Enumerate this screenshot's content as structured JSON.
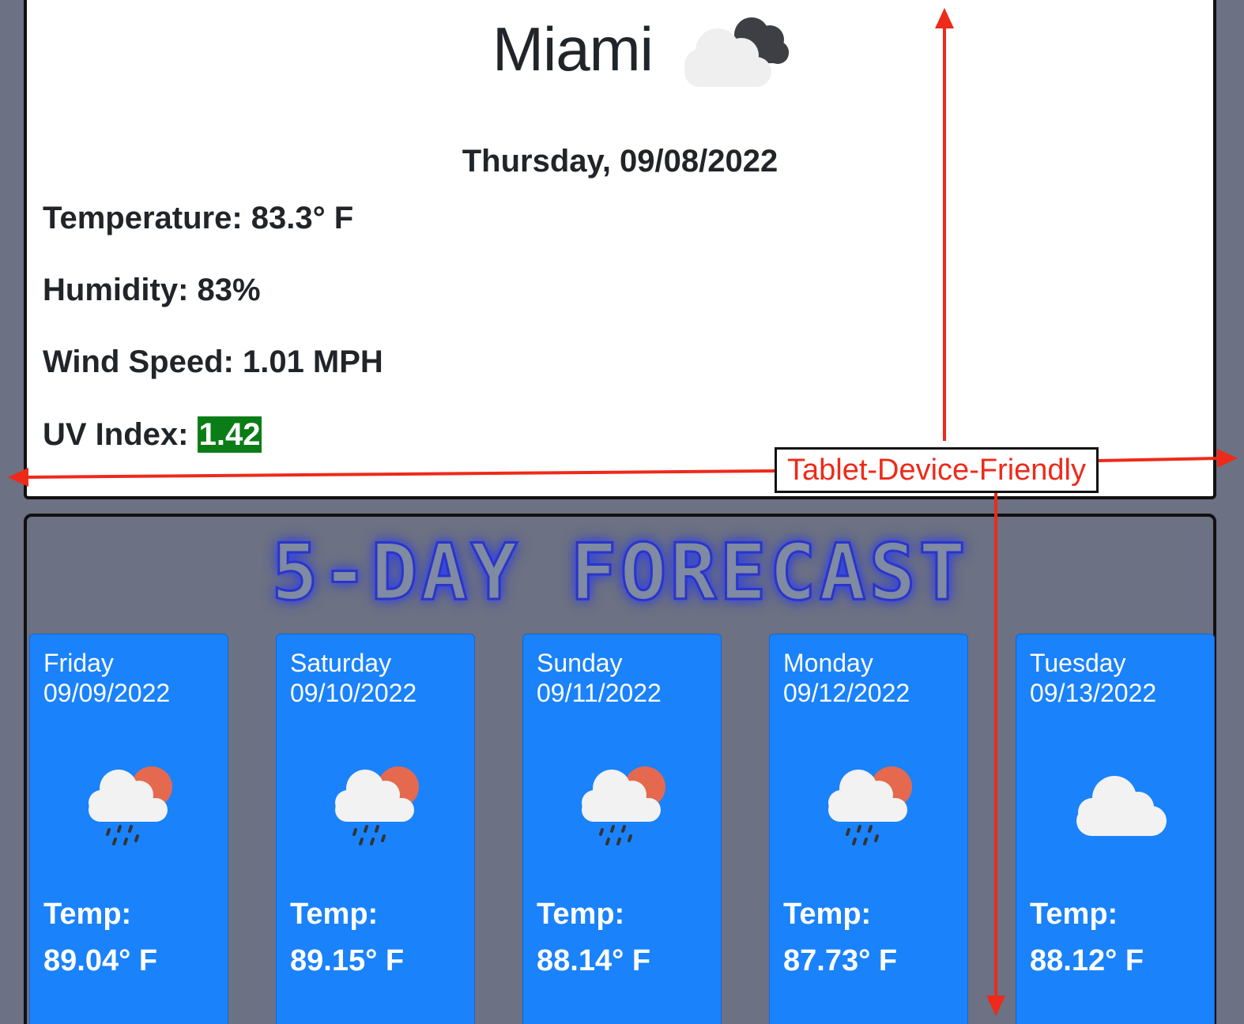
{
  "current": {
    "city": "Miami",
    "icon": "cloudy-icon",
    "date": "Thursday, 09/08/2022",
    "temperature": "Temperature: 83.3° F",
    "humidity": "Humidity: 83%",
    "wind": "Wind Speed: 1.01 MPH",
    "uv_label": "UV Index: ",
    "uv_value": "1.42",
    "uv_color": "#0a7d16"
  },
  "forecast": {
    "title": "5-DAY FORECAST",
    "days": [
      {
        "day": "Friday",
        "date": "09/09/2022",
        "icon": "rain-sun-icon",
        "temp_label": "Temp:",
        "temp": "89.04° F"
      },
      {
        "day": "Saturday",
        "date": "09/10/2022",
        "icon": "rain-sun-icon",
        "temp_label": "Temp:",
        "temp": "89.15° F"
      },
      {
        "day": "Sunday",
        "date": "09/11/2022",
        "icon": "rain-sun-icon",
        "temp_label": "Temp:",
        "temp": "88.14° F"
      },
      {
        "day": "Monday",
        "date": "09/12/2022",
        "icon": "rain-sun-icon",
        "temp_label": "Temp:",
        "temp": "87.73° F"
      },
      {
        "day": "Tuesday",
        "date": "09/13/2022",
        "icon": "cloud-icon",
        "temp_label": "Temp:",
        "temp": "88.12° F"
      }
    ]
  },
  "annotation": {
    "label": "Tablet-Device-Friendly",
    "color": "#ee2a1a"
  }
}
